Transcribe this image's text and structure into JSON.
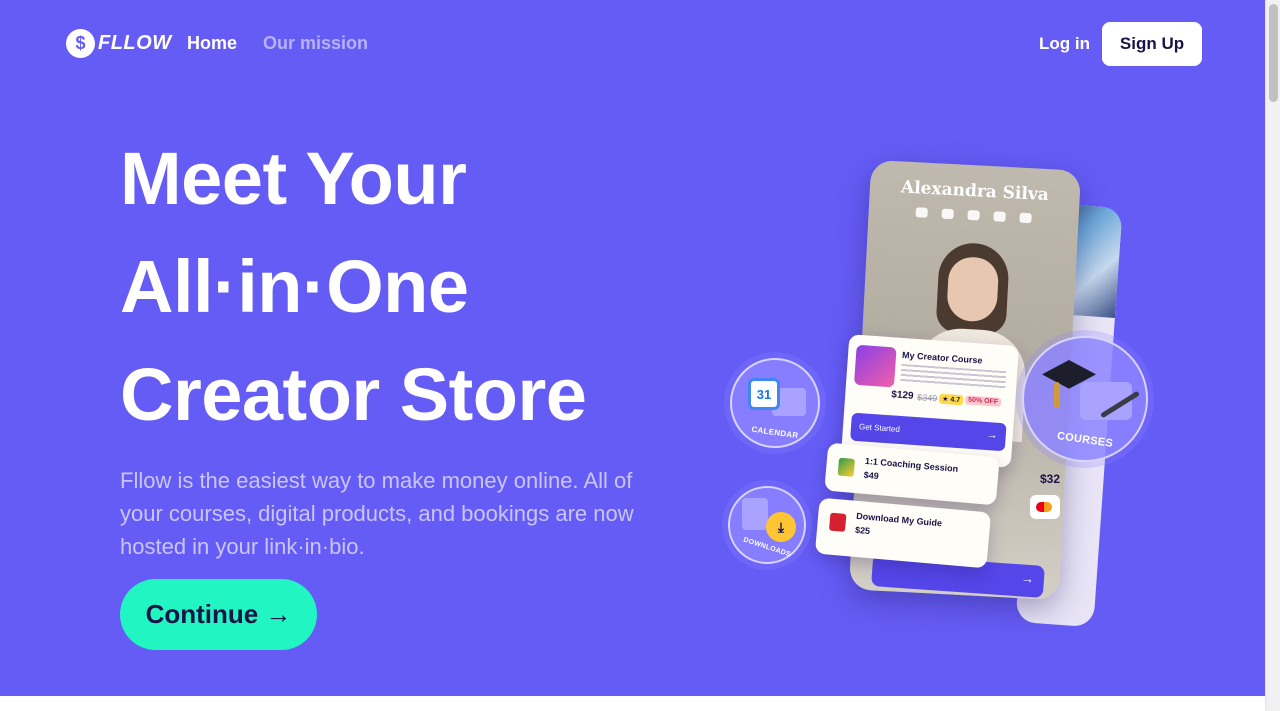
{
  "brand": {
    "logo_text": "FLLOW",
    "logo_symbol": "$"
  },
  "nav": {
    "home": "Home",
    "mission": "Our mission",
    "login": "Log in",
    "signup": "Sign Up"
  },
  "hero": {
    "headline": [
      "Meet Your",
      "All·in·One",
      "Creator Store"
    ],
    "subtitle": "Fllow is the easiest way to make money online. All of your courses, digital products, and bookings are now hosted in your link·in·bio.",
    "cta": "Continue →"
  },
  "illustration": {
    "profile_name": "Alexandra Silva",
    "course_card": {
      "title": "My Creator Course",
      "price": "$129",
      "old_price": "$349",
      "rating": "★ 4.7",
      "discount": "50% OFF",
      "button": "Get Started",
      "button_arrow": "→"
    },
    "coaching": {
      "title": "1:1 Coaching Session",
      "price": "$49"
    },
    "guide": {
      "title": "Download My Guide",
      "price": "$25"
    },
    "bubbles": {
      "calendar": "CALENDAR",
      "calendar_day": "31",
      "downloads": "DOWNLOADS",
      "courses": "COURSES",
      "download_icon": "⤓"
    },
    "side_price": "$32",
    "bottom_arrow": "→"
  },
  "colors": {
    "hero_bg": "#655cf6",
    "cta_bg": "#21f5c2",
    "subtitle": "#c9c5fb",
    "nav_muted": "#b7b2fb"
  }
}
